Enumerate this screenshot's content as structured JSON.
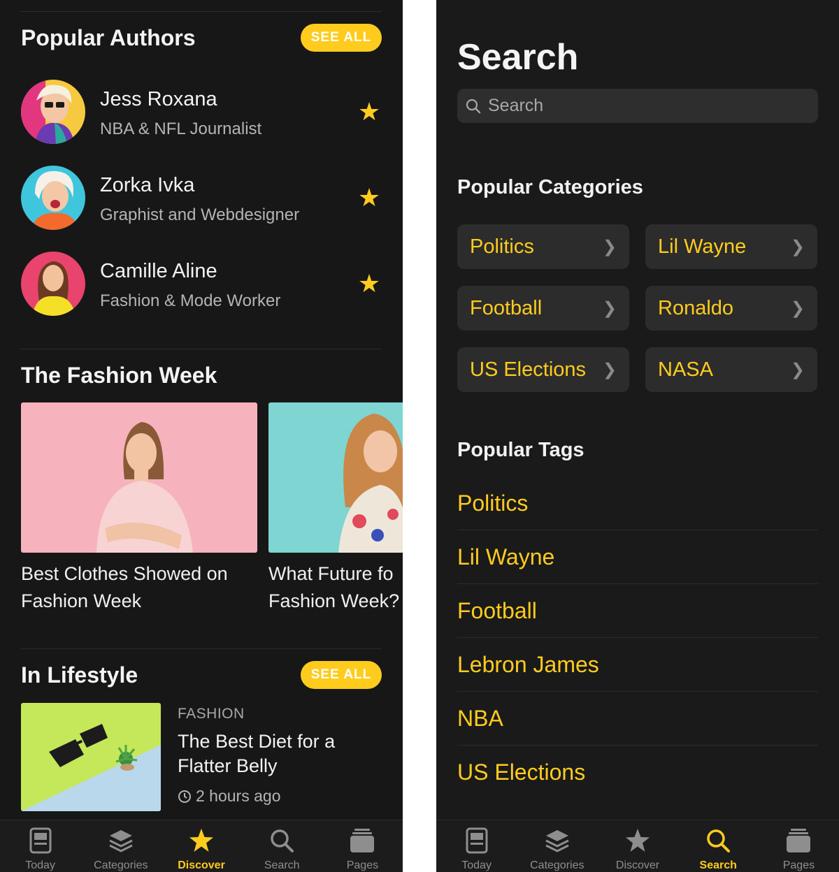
{
  "discover": {
    "authors_section": {
      "title": "Popular Authors",
      "see_all": "SEE ALL",
      "authors": [
        {
          "name": "Jess Roxana",
          "role": "NBA & NFL Journalist",
          "avatar_bg": "#f7c940",
          "favorite_icon": "star-icon"
        },
        {
          "name": "Zorka Ivka",
          "role": "Graphist and Webdesigner",
          "avatar_bg": "#3fc6dc",
          "favorite_icon": "star-icon"
        },
        {
          "name": "Camille Aline",
          "role": "Fashion & Mode Worker",
          "avatar_bg": "#e8446e",
          "favorite_icon": "star-icon"
        }
      ]
    },
    "fashion_section": {
      "title": "The Fashion Week",
      "cards": [
        {
          "title_line1": "Best Clothes Showed on",
          "title_line2": "Fashion Week",
          "image_bg": "#f6b2bd"
        },
        {
          "title_line1": "What Future fo",
          "title_line2": "Fashion Week?",
          "image_bg": "#7ed5d1"
        }
      ]
    },
    "lifestyle_section": {
      "title": "In Lifestyle",
      "see_all": "SEE ALL",
      "article": {
        "category": "FASHION",
        "title": "The Best Diet for a Flatter Belly",
        "time": "2 hours ago"
      }
    }
  },
  "search_screen": {
    "title": "Search",
    "search_placeholder": "Search",
    "categories_title": "Popular Categories",
    "categories": [
      "Politics",
      "Lil Wayne",
      "Football",
      "Ronaldo",
      "US Elections",
      "NASA"
    ],
    "tags_title": "Popular Tags",
    "tags": [
      "Politics",
      "Lil Wayne",
      "Football",
      "Lebron James",
      "NBA",
      "US Elections"
    ]
  },
  "tabbar": {
    "tabs": [
      {
        "label": "Today",
        "icon": "today-icon"
      },
      {
        "label": "Categories",
        "icon": "layers-icon"
      },
      {
        "label": "Discover",
        "icon": "star-icon"
      },
      {
        "label": "Search",
        "icon": "search-icon"
      },
      {
        "label": "Pages",
        "icon": "pages-icon"
      }
    ],
    "left_active": "Discover",
    "right_active": "Search"
  },
  "colors": {
    "accent": "#ffcc1e",
    "background": "#171717",
    "card": "#2c2c2c",
    "muted_text": "#b4b4b4"
  }
}
